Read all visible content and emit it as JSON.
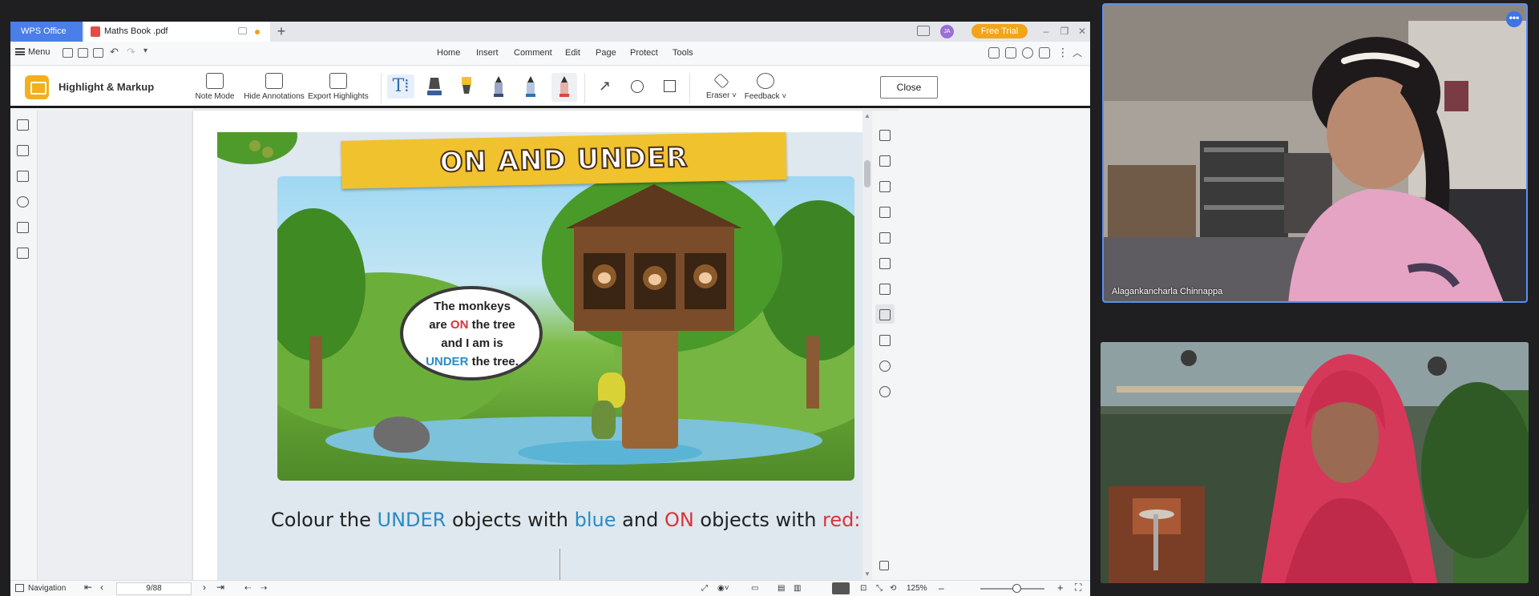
{
  "wps": {
    "brand_tab": "WPS Office",
    "doc_tab": "Maths Book .pdf",
    "free_trial": "Free Trial",
    "avatar_initials": "JA",
    "menu_label": "Menu",
    "ribbon_tabs": [
      "Home",
      "Insert",
      "Comment",
      "Edit",
      "Page",
      "Protect",
      "Tools"
    ],
    "mode_title": "Highlight & Markup",
    "toolbar": {
      "note_mode": "Note Mode",
      "hide_annotations": "Hide Annotations",
      "export_highlights": "Export Highlights",
      "eraser": "Eraser ˅",
      "feedback": "Feedback ˅",
      "close": "Close"
    },
    "pen_colors": [
      "#3a5d9c",
      "#f2c12e",
      "#3a4a7a",
      "#2e6fb3",
      "#d9473c"
    ],
    "status": {
      "navigation": "Navigation",
      "page": "9/88",
      "zoom": "125%"
    }
  },
  "document": {
    "banner_title": "ON AND UNDER",
    "bubble": {
      "line1": "The monkeys",
      "line2_a": "are ",
      "line2_on": "ON",
      "line2_b": " the tree",
      "line3": "and I am is",
      "line4_under": "UNDER",
      "line4_b": " the tree."
    },
    "instruction": {
      "part1": "Colour the ",
      "under": "UNDER",
      "part2": " objects with ",
      "blue": "blue",
      "part3": " and ",
      "on": "ON",
      "part4": " objects with ",
      "red": "red:"
    }
  },
  "participants": [
    {
      "name": "Alagankancharla Chinnappa"
    },
    {
      "name": ""
    }
  ]
}
